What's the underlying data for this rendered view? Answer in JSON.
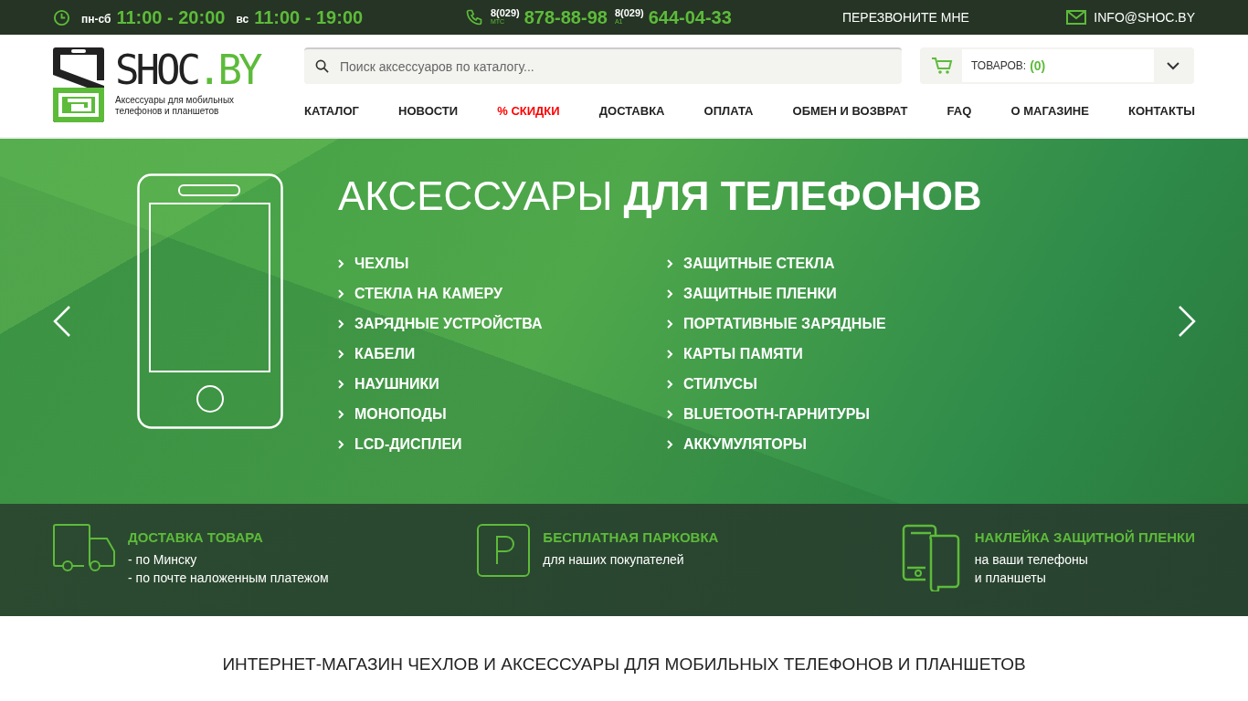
{
  "top_bar": {
    "hours": [
      {
        "days": "пн-сб",
        "time": "11:00 - 20:00"
      },
      {
        "days": "вс",
        "time": "11:00 - 19:00"
      }
    ],
    "phones": [
      {
        "code": "8(029)",
        "operator": "МТС",
        "number": "878-88-98"
      },
      {
        "code": "8(029)",
        "operator": "A1",
        "number": "644-04-33"
      }
    ],
    "callback": "ПЕРЕЗВОНИТЕ МНЕ",
    "email": "INFO@SHOC.BY"
  },
  "logo": {
    "name_main": "SHOC",
    "name_accent": ".BY",
    "tagline": "Аксессуары для мобильных телефонов и планшетов"
  },
  "search": {
    "placeholder": "Поиск аксессуаров по каталогу..."
  },
  "cart": {
    "label": "ТОВАРОВ:",
    "count": "(0)"
  },
  "nav": [
    {
      "label": "КАТАЛОГ",
      "kind": "normal"
    },
    {
      "label": "НОВОСТИ",
      "kind": "normal"
    },
    {
      "label": "% СКИДКИ",
      "kind": "sale"
    },
    {
      "label": "ДОСТАВКА",
      "kind": "normal"
    },
    {
      "label": "ОПЛАТА",
      "kind": "normal"
    },
    {
      "label": "ОБМЕН И ВОЗВРАТ",
      "kind": "normal"
    },
    {
      "label": "FAQ",
      "kind": "normal"
    },
    {
      "label": "О МАГАЗИНЕ",
      "kind": "normal"
    },
    {
      "label": "КОНТАКТЫ",
      "kind": "normal"
    }
  ],
  "banner": {
    "title": "АКСЕССУАРЫ **ДЛЯ ТЕЛЕФОНОВ**",
    "categories": [
      "ЧЕХЛЫ",
      "СТЕКЛА НА КАМЕРУ",
      "ЗАРЯДНЫЕ УСТРОЙСТВА",
      "КАБЕЛИ",
      "НАУШНИКИ",
      "МОНОПОДЫ",
      "LCD-ДИСПЛЕИ",
      "ЗАЩИТНЫЕ СТЕКЛА",
      "ЗАЩИТНЫЕ ПЛЕНКИ",
      "ПОРТАТИВНЫЕ ЗАРЯДНЫЕ",
      "КАРТЫ ПАМЯТИ",
      "СТИЛУСЫ",
      "BLUETOOTH-ГАРНИТУРЫ",
      "АККУМУЛЯТОРЫ"
    ]
  },
  "features": [
    {
      "kind": "truck",
      "title": "ДОСТАВКА ТОВАРА",
      "lines": [
        "- по Минску",
        "- по почте наложенным платежом"
      ]
    },
    {
      "kind": "parking",
      "title": "БЕСПЛАТНАЯ ПАРКОВКА",
      "lines": [
        "для наших покупателей"
      ]
    },
    {
      "kind": "devices",
      "title": "НАКЛЕЙКА ЗАЩИТНОЙ ПЛЕНКИ",
      "lines": [
        "на ваши телефоны",
        "и планшеты"
      ]
    }
  ],
  "heading": "ИНТЕРНЕТ-МАГАЗИН ЧЕХЛОВ И АКСЕССУАРЫ ДЛЯ МОБИЛЬНЫХ ТЕЛЕФОНОВ И ПЛАНШЕТОВ"
}
